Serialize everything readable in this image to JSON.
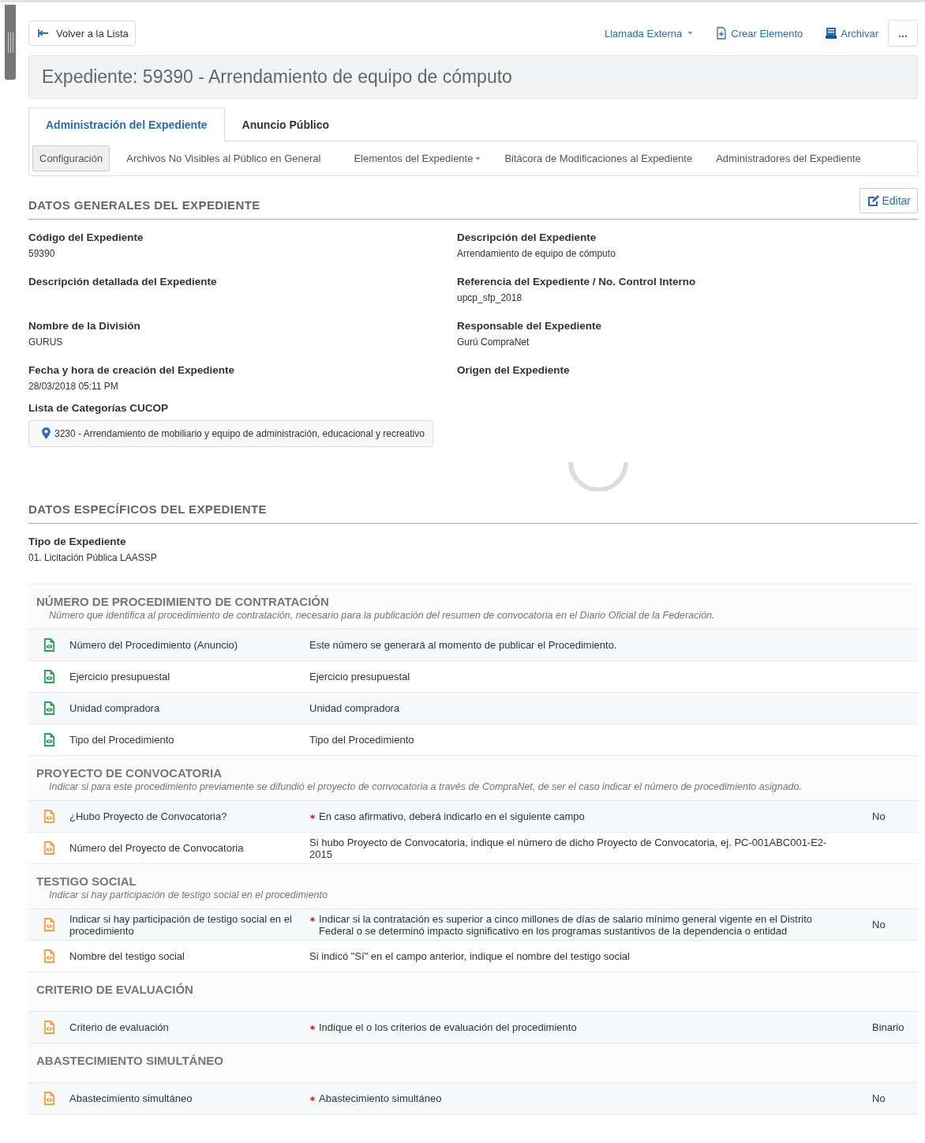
{
  "toolbar": {
    "back": "Volver a la Lista",
    "actions": [
      {
        "label": "Llamada Externa",
        "kind": "dropdown"
      },
      {
        "label": "Crear Elemento",
        "kind": "create"
      },
      {
        "label": "Archivar",
        "kind": "archive"
      }
    ],
    "more": "..."
  },
  "title": "Expediente: 59390 - Arrendamiento de equipo de cómputo",
  "tabs": [
    {
      "label": "Administración del Expediente",
      "selected": true
    },
    {
      "label": "Anuncio Público",
      "selected": false
    }
  ],
  "subtabs": [
    {
      "label": "Configuración",
      "selected": true,
      "dropdown": false
    },
    {
      "label": "Archivos No Visibles al Público en General",
      "selected": false,
      "dropdown": false
    },
    {
      "label": "Elementos del Expediente",
      "selected": false,
      "dropdown": true
    },
    {
      "label": "Bitácora de Modificaciones al Expediente",
      "selected": false,
      "dropdown": false
    },
    {
      "label": "Administradores del Expediente",
      "selected": false,
      "dropdown": false
    }
  ],
  "general": {
    "heading": "DATOS GENERALES DEL EXPEDIENTE",
    "edit": "Editar",
    "fields": [
      {
        "label": "Código del Expediente",
        "value": "59390"
      },
      {
        "label": "Descripción del Expediente",
        "value": "Arrendamiento de equipo de cómputo"
      },
      {
        "label": "Descripción detallada del Expediente"
      },
      {
        "label": "Referencia del Expediente / No. Control Interno",
        "value": "upcp_sfp_2018"
      },
      {
        "label": "Nombre de la División",
        "value": "GURUS"
      },
      {
        "label": "Responsable del Expediente",
        "value": "Gurú CompraNet"
      },
      {
        "label": "Fecha y hora de creación del Expediente",
        "value": "28/03/2018 05:11 PM"
      },
      {
        "label": "Origen del Expediente"
      }
    ],
    "categories_label": "Lista de Categorías CUCOP",
    "categories": [
      "3230 - Arrendamiento de mobiliario y equipo de administración, educacional y recreativo"
    ]
  },
  "specific": {
    "heading": "DATOS ESPECÍFICOS DEL EXPEDIENTE",
    "type_label": "Tipo de Expediente",
    "type_value": "01. Licitación Pública LAASSP",
    "sections": [
      {
        "title": "NÚMERO DE PROCEDIMIENTO DE CONTRATACIÓN",
        "description": "Número que identifica al procedimiento de contratación, necesario para la publicación del resumen de convocatoria en el Diario Oficial de la Federación.",
        "rows": [
          {
            "color": "#2e9e5b",
            "name": "Número del Procedimiento (Anuncio)",
            "required": false,
            "hint": "Este número se generará al momento de publicar el Procedimiento."
          },
          {
            "color": "#2e9e5b",
            "name": "Ejercicio presupuestal",
            "required": false,
            "hint": "Ejercicio presupuestal"
          },
          {
            "color": "#2e9e5b",
            "name": "Unidad compradora",
            "required": false,
            "hint": "Unidad compradora"
          },
          {
            "color": "#2e9e5b",
            "name": "Tipo del Procedimiento",
            "required": false,
            "hint": "Tipo del Procedimiento"
          }
        ]
      },
      {
        "title": "PROYECTO DE CONVOCATORIA",
        "description": "Indicar si para este procedimiento previamente se difundió el proyecto de convocatoria a través de CompraNet, de ser el caso indicar el número de procedimiento asignado.",
        "rows": [
          {
            "color": "#f5a045",
            "name": "¿Hubo Proyecto de Convocatoria?",
            "required": true,
            "hint": "En caso afirmativo, deberá indicarlo en el siguiente campo",
            "value": "No"
          },
          {
            "color": "#f5a045",
            "name": "Número del Proyecto de Convocatoria",
            "required": false,
            "hint": "Si hubo Proyecto de Convocatoria, indique el número de dicho Proyecto de Convocatoria, ej. PC-001ABC001-E2-2015"
          }
        ]
      },
      {
        "title": "TESTIGO SOCIAL",
        "description": "Indicar si hay participación de testigo social en el procedimiento",
        "rows": [
          {
            "color": "#f5a045",
            "name": "Indicar si hay participación de testigo social en el procedimiento",
            "required": true,
            "hint": "Indicar si la contratación es superior a cinco millones de días de salario mínimo general vigente en el Distrito Federal o se determinó impacto significativo en los programas sustantivos de la dependencia o entidad",
            "value": "No"
          },
          {
            "color": "#f5a045",
            "name": "Nombre del testigo social",
            "required": false,
            "hint": "Si indicó \"Sí\" en el campo anterior, indique el nombre del testigo social"
          }
        ]
      },
      {
        "title": "CRITERIO DE EVALUACIÓN",
        "rows": [
          {
            "color": "#f5a045",
            "name": "Criterio de evaluación",
            "required": true,
            "hint": "Indique el o los criterios de evaluación del procedimiento",
            "value": "Binario"
          }
        ]
      },
      {
        "title": "ABASTECIMIENTO SIMULTÁNEO",
        "rows": [
          {
            "color": "#f5a045",
            "name": "Abastecimiento simultáneo",
            "required": true,
            "hint": "Abastecimiento simultáneo",
            "value": "No"
          }
        ]
      }
    ]
  }
}
